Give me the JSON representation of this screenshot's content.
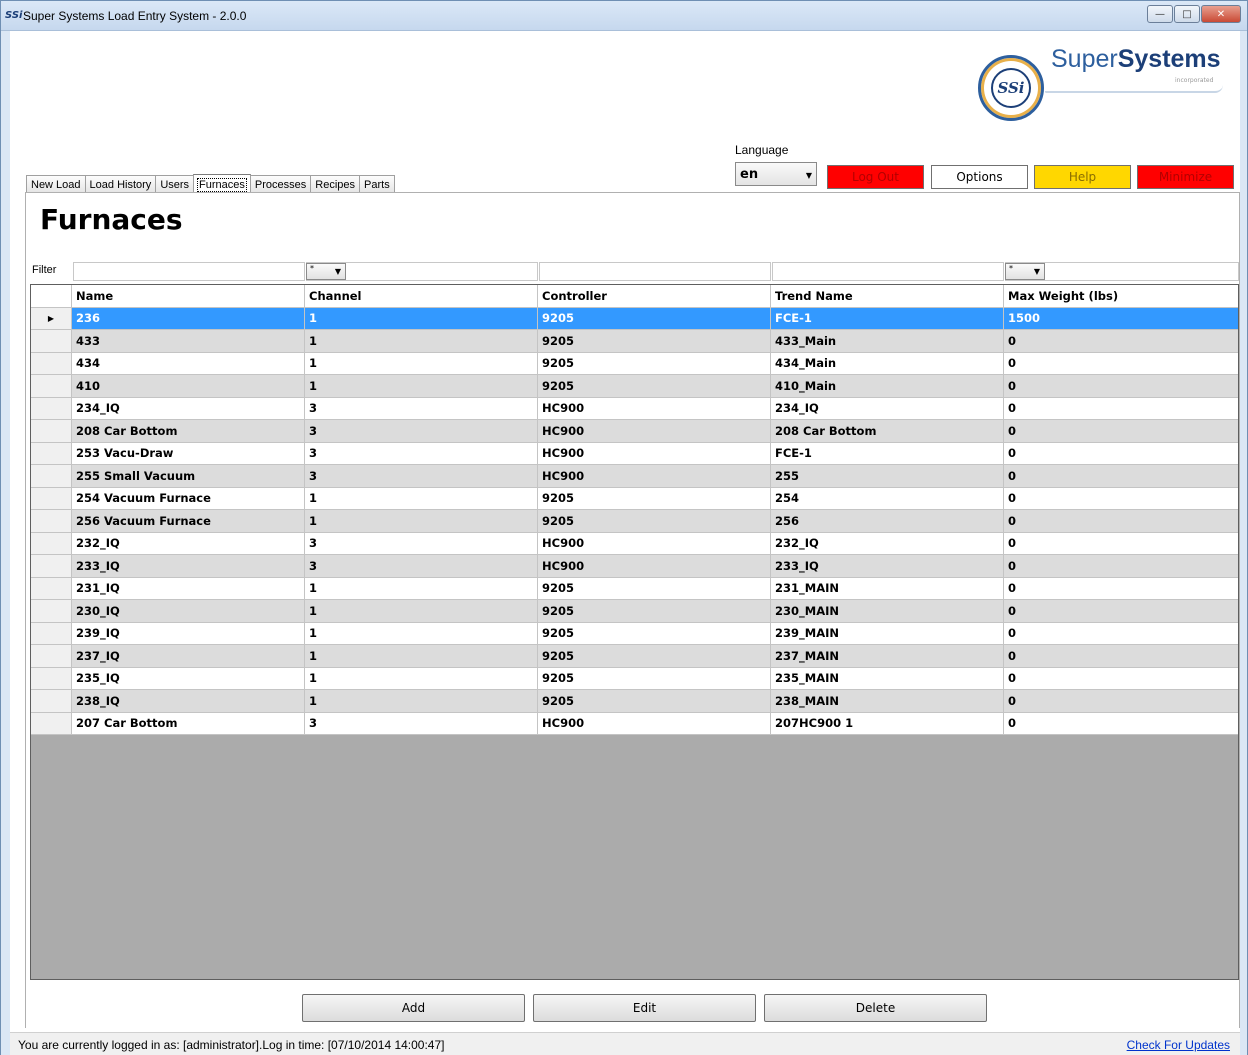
{
  "window": {
    "title": "Super Systems Load Entry System - 2.0.0",
    "icon_text": "SSi"
  },
  "brand": {
    "logo_text": "SSi",
    "name_part1": "Super",
    "name_part2": "Systems",
    "tagline": "incorporated"
  },
  "tabs": [
    "New Load",
    "Load History",
    "Users",
    "Furnaces",
    "Processes",
    "Recipes",
    "Parts"
  ],
  "active_tab": "Furnaces",
  "language": {
    "label": "Language",
    "value": "en"
  },
  "toolbar": {
    "logout": "Log Out",
    "options": "Options",
    "help": "Help",
    "minimize": "Minimize"
  },
  "colors": {
    "selection": "#3399ff",
    "logout": "#ff0000",
    "help": "#ffd700",
    "minimize": "#ff0000"
  },
  "page": {
    "title": "Furnaces",
    "filter_label": "Filter",
    "filter_dropdown_channel": "*",
    "filter_dropdown_weight": "*"
  },
  "grid": {
    "columns": [
      "Name",
      "Channel",
      "Controller",
      "Trend Name",
      "Max Weight (lbs)"
    ],
    "selected_row": 0,
    "rows": [
      [
        "236",
        "1",
        "9205",
        "FCE-1",
        "1500"
      ],
      [
        "433",
        "1",
        "9205",
        "433_Main",
        "0"
      ],
      [
        "434",
        "1",
        "9205",
        "434_Main",
        "0"
      ],
      [
        "410",
        "1",
        "9205",
        "410_Main",
        "0"
      ],
      [
        "234_IQ",
        "3",
        "HC900",
        "234_IQ",
        "0"
      ],
      [
        "208 Car Bottom",
        "3",
        "HC900",
        "208 Car Bottom",
        "0"
      ],
      [
        "253 Vacu-Draw",
        "3",
        "HC900",
        "FCE-1",
        "0"
      ],
      [
        "255 Small Vacuum",
        "3",
        "HC900",
        "255",
        "0"
      ],
      [
        "254 Vacuum Furnace",
        "1",
        "9205",
        "254",
        "0"
      ],
      [
        "256 Vacuum Furnace",
        "1",
        "9205",
        "256",
        "0"
      ],
      [
        "232_IQ",
        "3",
        "HC900",
        "232_IQ",
        "0"
      ],
      [
        "233_IQ",
        "3",
        "HC900",
        "233_IQ",
        "0"
      ],
      [
        "231_IQ",
        "1",
        "9205",
        "231_MAIN",
        "0"
      ],
      [
        "230_IQ",
        "1",
        "9205",
        "230_MAIN",
        "0"
      ],
      [
        "239_IQ",
        "1",
        "9205",
        "239_MAIN",
        "0"
      ],
      [
        "237_IQ",
        "1",
        "9205",
        "237_MAIN",
        "0"
      ],
      [
        "235_IQ",
        "1",
        "9205",
        "235_MAIN",
        "0"
      ],
      [
        "238_IQ",
        "1",
        "9205",
        "238_MAIN",
        "0"
      ],
      [
        "207 Car Bottom",
        "3",
        "HC900",
        "207HC900 1",
        "0"
      ]
    ]
  },
  "actions": {
    "add": "Add",
    "edit": "Edit",
    "delete": "Delete"
  },
  "status": {
    "text": "You are currently logged in as: [administrator].Log in time: [07/10/2014 14:00:47]",
    "link": "Check For Updates"
  }
}
